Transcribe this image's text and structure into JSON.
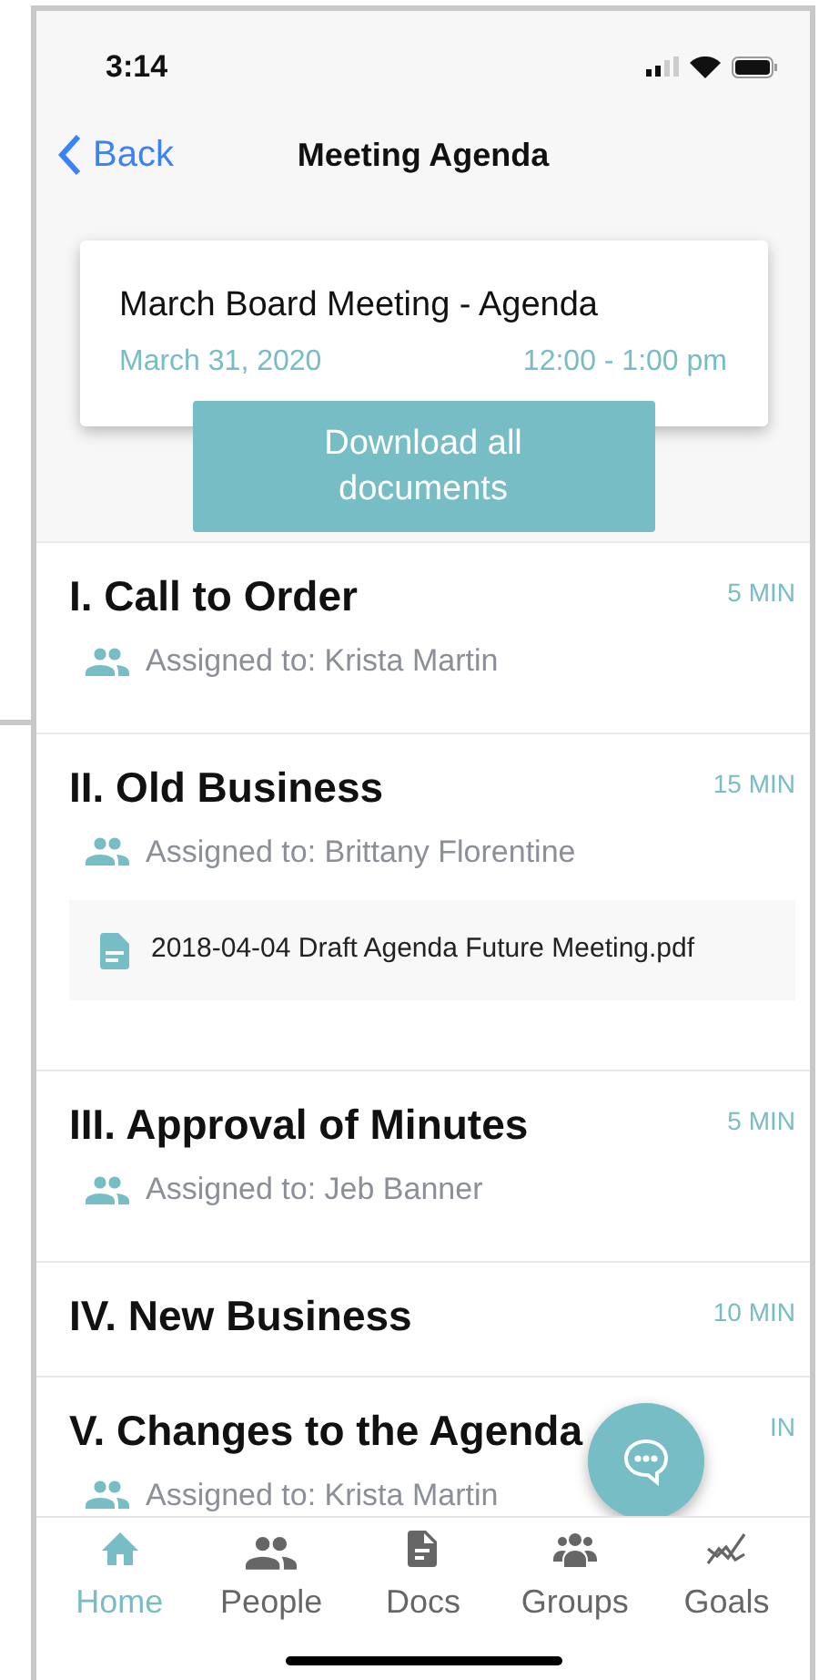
{
  "status_bar": {
    "time": "3:14"
  },
  "nav": {
    "back": "Back",
    "title": "Meeting Agenda"
  },
  "meeting": {
    "title": "March Board Meeting - Agenda",
    "date": "March 31, 2020",
    "time": "12:00 - 1:00 pm"
  },
  "download_button": "Download all documents",
  "agenda_items": [
    {
      "title": "I. Call to Order",
      "duration": "5 MIN",
      "assigned": "Assigned to: Krista Martin"
    },
    {
      "title": "II. Old Business",
      "duration": "15 MIN",
      "assigned": "Assigned to: Brittany Florentine",
      "documents": [
        "2018-04-04 Draft Agenda Future Meeting.pdf"
      ]
    },
    {
      "title": "III. Approval of Minutes",
      "duration": "5 MIN",
      "assigned": "Assigned to: Jeb Banner"
    },
    {
      "title": "IV. New Business",
      "duration": "10 MIN"
    },
    {
      "title": "V. Changes to the Agenda",
      "duration": "IN",
      "assigned": "Assigned to: Krista Martin"
    }
  ],
  "tabs": [
    {
      "label": "Home",
      "kind": "home",
      "selected": true
    },
    {
      "label": "People",
      "kind": "people",
      "selected": false
    },
    {
      "label": "Docs",
      "kind": "doc",
      "selected": false
    },
    {
      "label": "Groups",
      "kind": "groups",
      "selected": false
    },
    {
      "label": "Goals",
      "kind": "goals",
      "selected": false
    }
  ]
}
